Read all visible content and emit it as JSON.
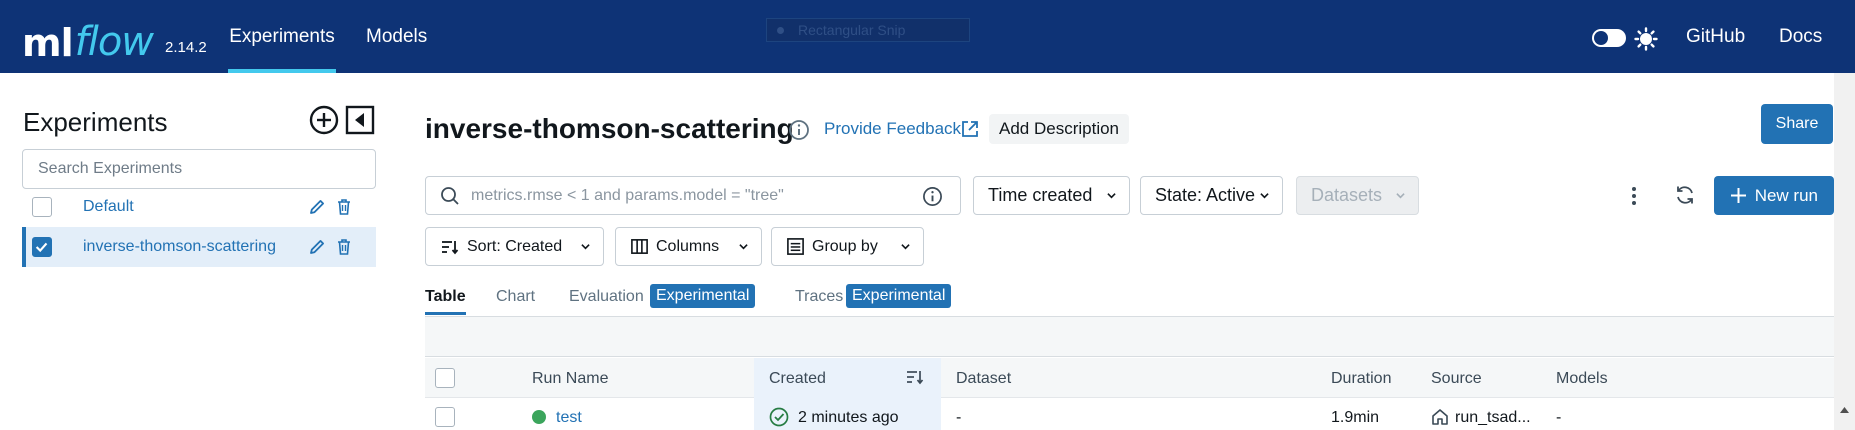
{
  "app": {
    "logo_ml": "ml",
    "logo_flow": "flow",
    "version": "2.14.2",
    "nav": [
      "Experiments",
      "Models"
    ],
    "ghost_label": "Rectangular Snip",
    "right_links": [
      "GitHub",
      "Docs"
    ]
  },
  "colors": {
    "header": "#0e3376",
    "accent": "#2272b4",
    "logo_accent": "#43c9ed"
  },
  "sidebar": {
    "title": "Experiments",
    "search_placeholder": "Search Experiments",
    "experiments": [
      {
        "name": "Default",
        "checked": false
      },
      {
        "name": "inverse-thomson-scattering",
        "checked": true
      }
    ]
  },
  "main": {
    "experiment_name": "inverse-thomson-scattering",
    "feedback_label": "Provide Feedback",
    "add_description_label": "Add Description",
    "share_label": "Share",
    "filter_placeholder": "metrics.rmse < 1 and params.model = \"tree\"",
    "time_created_label": "Time created",
    "state_label": "State: Active",
    "datasets_label": "Datasets",
    "new_run_label": "New run",
    "sort_label": "Sort: Created",
    "columns_label": "Columns",
    "group_by_label": "Group by",
    "tabs": [
      {
        "label": "Table",
        "badge": ""
      },
      {
        "label": "Chart",
        "badge": ""
      },
      {
        "label": "Evaluation",
        "badge": "Experimental"
      },
      {
        "label": "Traces",
        "badge": "Experimental"
      }
    ],
    "columns": [
      "Run Name",
      "Created",
      "Dataset",
      "Duration",
      "Source",
      "Models"
    ],
    "rows": [
      {
        "run_name": "test",
        "created": "2 minutes ago",
        "dataset": "-",
        "duration": "1.9min",
        "source": "run_tsad...",
        "models": "-"
      }
    ]
  }
}
